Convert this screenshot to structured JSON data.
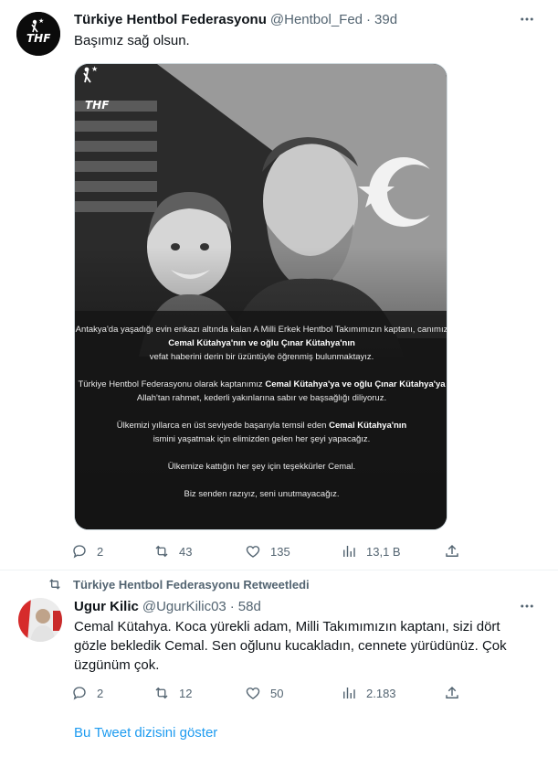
{
  "tweet1": {
    "author_name": "Türkiye Hentbol Federasyonu",
    "author_handle": "@Hentbol_Fed",
    "dot": "·",
    "time": "39d",
    "text": "Başımız sağ olsun.",
    "media": {
      "logo_text": "THF",
      "caption": {
        "p1": "Antakya'da yaşadığı evin enkazı altında kalan A Milli Erkek Hentbol Takımımızın kaptanı, canımız",
        "p1_bold1": "Cemal Kütahya'nın ve oğlu Çınar Kütahya'nın",
        "p1_end": "vefat haberini derin bir üzüntüyle öğrenmiş bulunmaktayız.",
        "p2": "Türkiye Hentbol Federasyonu olarak kaptanımız",
        "p2_bold1": "Cemal Kütahya'ya ve oğlu Çınar Kütahya'ya",
        "p2_end": "Allah'tan rahmet, kederli yakınlarına sabır ve başsağlığı diliyoruz.",
        "p3": "Ülkemizi yıllarca en üst seviyede başarıyla temsil eden",
        "p3_bold1": "Cemal Kütahya'nın",
        "p3_end": "ismini yaşatmak için elimizden gelen her şeyi yapacağız.",
        "p4": "Ülkemize kattığın her şey için teşekkürler Cemal.",
        "p5": "Biz senden razıyız, seni unutmayacağız."
      }
    },
    "actions": {
      "replies": "2",
      "retweets": "43",
      "likes": "135",
      "views": "13,1 B"
    }
  },
  "tweet2": {
    "retweet_banner": "Türkiye Hentbol Federasyonu Retweetledi",
    "author_name": "Ugur Kilic",
    "author_handle": "@UgurKilic03",
    "dot": "·",
    "time": "58d",
    "text": "Cemal Kütahya. Koca yürekli adam, Milli Takımımızın kaptanı, sizi dört gözle bekledik Cemal. Sen oğlunu kucakladın, cennete yürüdünüz. Çok üzgünüm çok.",
    "actions": {
      "replies": "2",
      "retweets": "12",
      "likes": "50",
      "views": "2.183"
    }
  },
  "show_thread": "Bu Tweet dizisini göster",
  "colors": {
    "accent": "#1d9bf0",
    "secondary_text": "#536471",
    "border": "#eff3f4"
  }
}
